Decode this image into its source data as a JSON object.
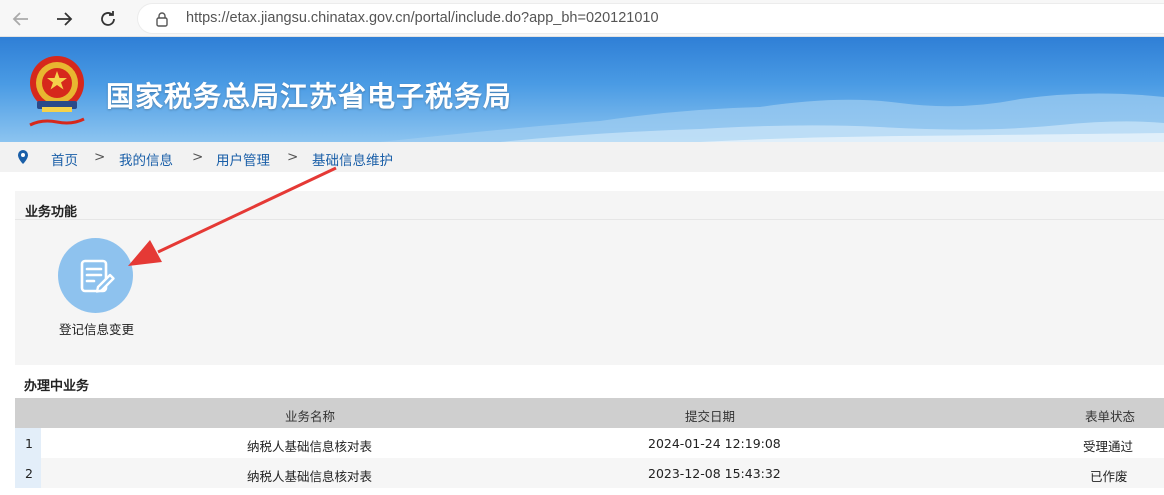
{
  "browser": {
    "url": "https://etax.jiangsu.chinatax.gov.cn/portal/include.do?app_bh=020121010"
  },
  "header": {
    "title": "国家税务总局江苏省电子税务局"
  },
  "breadcrumb": {
    "items": [
      "首页",
      "我的信息",
      "用户管理",
      "基础信息维护"
    ],
    "separator": ">"
  },
  "business": {
    "section_title": "业务功能",
    "functions": [
      {
        "label": "登记信息变更",
        "icon": "edit-document-icon"
      }
    ]
  },
  "in_process": {
    "section_title": "办理中业务",
    "columns": [
      "业务名称",
      "提交日期",
      "表单状态"
    ],
    "rows": [
      {
        "index": "1",
        "name": "纳税人基础信息核对表",
        "date": "2024-01-24 12:19:08",
        "status": "受理通过"
      },
      {
        "index": "2",
        "name": "纳税人基础信息核对表",
        "date": "2023-12-08 15:43:32",
        "status": "已作废"
      }
    ]
  },
  "colors": {
    "banner": "#2f7fd6",
    "link": "#1a5fa8",
    "icon_circle": "#8ec2ee",
    "arrow": "#e53935"
  }
}
